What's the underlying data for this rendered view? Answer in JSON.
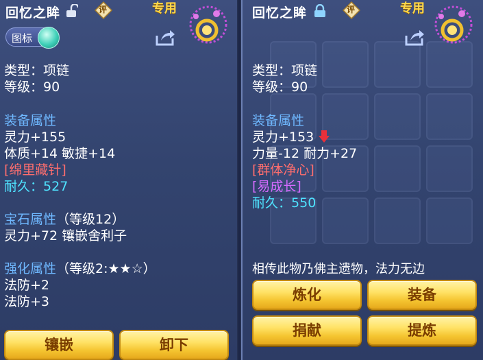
{
  "left": {
    "title": "回忆之眸",
    "exclusive": "专用",
    "review_badge": "评",
    "toggle_label": "图标",
    "type_line": "类型：项链",
    "level_line": "等级：90",
    "equip_attr_head": "装备属性",
    "attr1": "灵力+155",
    "attr2": "体质+14 敏捷+14",
    "special": "[绵里藏针]",
    "durability_label": "耐久：",
    "durability_value": "527",
    "gem_head": "宝石属性",
    "gem_level": "（等级12）",
    "gem_attr": "灵力+72 镶嵌舍利子",
    "enhance_head": "强化属性",
    "enhance_level": "（等级2:★★☆）",
    "enhance1": "法防+2",
    "enhance2": "法防+3",
    "buttons": {
      "inlay": "镶嵌",
      "unequip": "卸下"
    }
  },
  "right": {
    "title": "回忆之眸",
    "exclusive": "专用",
    "review_badge": "评",
    "type_line": "类型：项链",
    "level_line": "等级：90",
    "equip_attr_head": "装备属性",
    "attr1": "灵力+153",
    "attr2": "力量-12 耐力+27",
    "special1": "[群体净心]",
    "special2": "[易成长]",
    "durability_label": "耐久：",
    "durability_value": "550",
    "description": "相传此物乃佛主遗物，法力无边",
    "buttons": {
      "refine": "炼化",
      "equip": "装备",
      "donate": "捐献",
      "extract": "提炼"
    }
  },
  "colors": {
    "header_blue": "#6fb8ff",
    "cyan_value": "#4fe3ff",
    "special_red": "#ff6e6e",
    "special_purple": "#d46bff",
    "button_gold": "#ffe266",
    "down_arrow": "#e8303a"
  },
  "icons": {
    "lock_open": "unlocked-padlock-icon",
    "lock_closed": "locked-padlock-icon",
    "share": "share-arrow-icon",
    "item": "necklace-icon",
    "stat_down": "red-down-arrow-icon"
  }
}
